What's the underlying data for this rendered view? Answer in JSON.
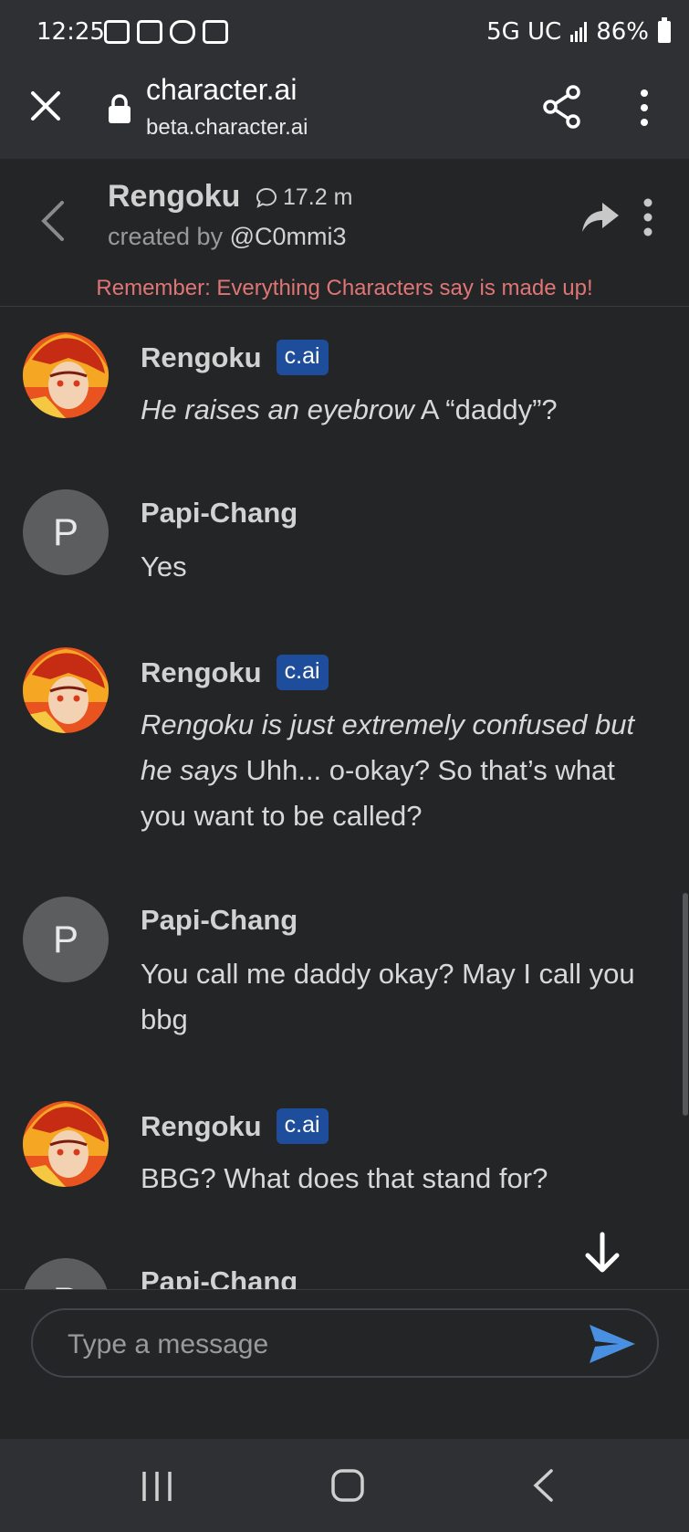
{
  "status_bar": {
    "time": "12:25",
    "network": "5G UC",
    "battery": "86%"
  },
  "browser": {
    "title": "character.ai",
    "url": "beta.character.ai"
  },
  "chat_header": {
    "name": "Rengoku",
    "interactions": "17.2 m",
    "created_by_prefix": "created by ",
    "creator": "@C0mmi3",
    "disclaimer": "Remember: Everything Characters say is made up!"
  },
  "messages": [
    {
      "sender": "Rengoku",
      "badge": "c.ai",
      "italic": "He raises an eyebrow",
      "text": " A “daddy”?"
    },
    {
      "sender": "Papi-Chang",
      "initial": "P",
      "text": "Yes"
    },
    {
      "sender": "Rengoku",
      "badge": "c.ai",
      "italic": "Rengoku is just extremely confused but he says",
      "text": " Uhh... o-okay? So that’s what you want to be called?"
    },
    {
      "sender": "Papi-Chang",
      "initial": "P",
      "text": "You call me daddy okay? May I call you bbg"
    },
    {
      "sender": "Rengoku",
      "badge": "c.ai",
      "text": "BBG? What does that stand for?"
    },
    {
      "sender": "Papi-Chang",
      "initial": "P",
      "text": ""
    }
  ],
  "input": {
    "placeholder": "Type a message"
  },
  "colors": {
    "background": "#242526",
    "bars": "#2f3033",
    "badge": "#1e4d9c",
    "disclaimer": "#e07575",
    "send": "#4a90e2"
  }
}
